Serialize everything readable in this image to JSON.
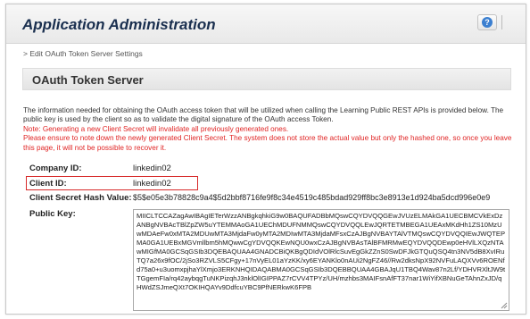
{
  "header": {
    "title": "Application Administration",
    "help_icon": "question-circle-icon",
    "help_glyph": "?"
  },
  "breadcrumb": "> Edit OAuth Token Server Settings",
  "section": {
    "title": "OAuth Token Server"
  },
  "description": {
    "info": "The information needed for obtaining the OAuth access token that will be utilized when calling the Learning Public REST APIs is provided below. The public key is used by the client so as to validate the digital signature of the OAuth access Token.",
    "note": "Note: Generating a new Client Secret will invalidate all previously generated ones.",
    "warning": "Please ensure to note down the newly generated Client Secret. The system does not store the actual value but only the hashed one, so once you leave this page, it will not be possible to recover it."
  },
  "fields": {
    "company_id": {
      "label": "Company ID:",
      "value": "linkedin02"
    },
    "client_id": {
      "label": "Client ID:",
      "value": "linkedin02"
    },
    "client_secret_hash": {
      "label": "Client Secret Hash Value:",
      "value": "$5$e05e3b78828c9a4$5d2bbf8716fe9f8c34e4519c485bdad929ff8bc3e8913e1d924ba5dcd996e0e9"
    },
    "public_key": {
      "label": "Public Key:",
      "value": "MIICLTCCAZagAwIBAgIETerWzzANBgkqhkiG9w0BAQUFADBbMQswCQYDVQQGEwJVUzELMAkGA1UECBMCVkExDzANBgNVBAcTBlZpZW5uYTEMMAoGA1UEChMDUFNMMQswCQYDVQQLEwJQRTETMBEGA1UEAxMKdHh1ZS10MzUwMDAeFw0xMTA2MDUwMTA3MjdaFw0yMTA2MDIwMTA3MjdaMFsxCzAJBgNVBAYTAlVTMQswCQYDVQQIEwJWQTEPMA0GA1UEBxMGVmllbm5hMQwwCgYDVQQKEwNQU0wxCzAJBgNVBAsTAlBFMRMwEQYDVQQDEwp0eHVlLXQzNTAwMIGfMA0GCSqGSIb3DQEBAQUAA4GNADCBiQKBgQDIdVOlRlcSuvEgGkZZnS0SwDFJkGTQuQSQ4tn3NV5dB8XvIRuTQ7a26x9fOC/2jSo3RZVLS5CFgy+17nVyEL01aYzKK/xy6EYANKlo0nAUi2NgFZ46//Rw2dksNpX92NVFuLAQXVv6ROENfd75a0+u3uomxpjhaYlXmjo3ERKNHQIDAQABMA0GCSqGSIb3DQEBBQUAA4GBAJqU1TBQ4Wav87n2Lf/YDHVRXltJW9tTGgemFIa/rq42aybqgTuNKPizqhJ3nklOlIGIPPAZ7rCVV4TPYz/UH/mzhbs3MAIFsnAfFT37nar1WiYifXBNuGeTAhnZxJD/qHWdZSJmeQXt7OKIHQAYv9DdfcuYBC9PfNERkwK6FPB"
    }
  },
  "colors": {
    "warning": "#e02424",
    "highlight_border": "#d72a2a",
    "title": "#1a2f4f"
  }
}
